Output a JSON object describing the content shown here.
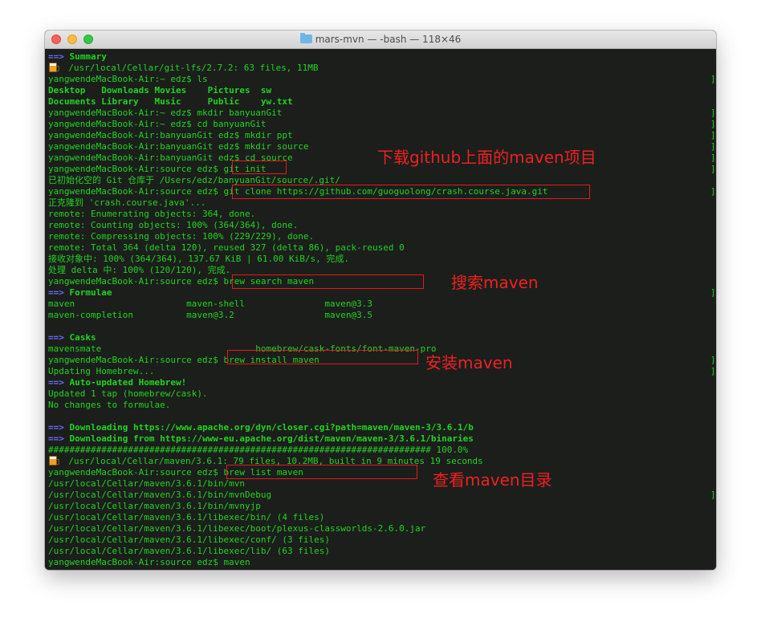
{
  "window": {
    "title": "mars-mvn — -bash — 118×46"
  },
  "icons": {
    "folder": "folder-icon",
    "beer": "beer-mug-icon",
    "traffic_lights": [
      "close-button",
      "minimize-button",
      "zoom-button"
    ]
  },
  "colors": {
    "terminal_bg": "#1c1e1c",
    "terminal_text": "#1fd51f",
    "arrow_blue": "#6b6bff",
    "annotation_red": "#ee2020"
  },
  "terminal": {
    "lines": [
      {
        "prefix": "==>",
        "text": "Summary",
        "bold": true
      },
      {
        "icon": "beer",
        "text": "  /usr/local/Cellar/git-lfs/2.7.2: 63 files, 11MB"
      },
      {
        "text": "yangwendeMacBook-Air:~ edz$ ls",
        "bracket": true
      },
      {
        "text": "Desktop   Downloads Movies    Pictures  sw",
        "bold": true
      },
      {
        "text": "Documents Library   Music     Public    yw.txt",
        "bold": true
      },
      {
        "text": "yangwendeMacBook-Air:~ edz$ mkdir banyuanGit",
        "bracket": true
      },
      {
        "text": "yangwendeMacBook-Air:~ edz$ cd banyuanGit",
        "bracket": true
      },
      {
        "text": "yangwendeMacBook-Air:banyuanGit edz$ mkdir ppt",
        "bracket": true
      },
      {
        "text": "yangwendeMacBook-Air:banyuanGit edz$ mkdir source",
        "bracket": true
      },
      {
        "text": "yangwendeMacBook-Air:banyuanGit edz$ cd source",
        "bracket": true
      },
      {
        "text": "yangwendeMacBook-Air:source edz$ git init",
        "bracket": true
      },
      {
        "text": "已初始化空的 Git 仓库于 /Users/edz/banyuanGit/source/.git/"
      },
      {
        "text": "yangwendeMacBook-Air:source edz$ git clone https://github.com/guoguolong/crash.course.java.git",
        "bracket": true
      },
      {
        "text": "正克隆到 'crash.course.java'..."
      },
      {
        "text": "remote: Enumerating objects: 364, done."
      },
      {
        "text": "remote: Counting objects: 100% (364/364), done."
      },
      {
        "text": "remote: Compressing objects: 100% (229/229), done."
      },
      {
        "text": "remote: Total 364 (delta 120), reused 327 (delta 86), pack-reused 0"
      },
      {
        "text": "接收对象中: 100% (364/364), 137.67 KiB | 61.00 KiB/s, 完成."
      },
      {
        "text": "处理 delta 中: 100% (120/120), 完成."
      },
      {
        "text": "yangwendeMacBook-Air:source edz$ brew search maven"
      },
      {
        "prefix": "==>",
        "text": "Formulae",
        "bold": true,
        "bracket": true
      },
      {
        "text": "maven                     maven-shell               maven@3.3"
      },
      {
        "text": "maven-completion          maven@3.2                 maven@3.5"
      },
      {
        "text": ""
      },
      {
        "prefix": "==>",
        "text": "Casks",
        "bold": true
      },
      {
        "text": "mavensmate                             homebrew/cask-fonts/font-maven-pro"
      },
      {
        "text": "yangwendeMacBook-Air:source edz$ brew install maven",
        "bracket": true
      },
      {
        "text": "Updating Homebrew...",
        "bracket": true
      },
      {
        "prefix": "==>",
        "text": "Auto-updated Homebrew!",
        "bold": true
      },
      {
        "text": "Updated 1 tap (homebrew/cask)."
      },
      {
        "text": "No changes to formulae."
      },
      {
        "text": ""
      },
      {
        "prefix": "==>",
        "text": "Downloading https://www.apache.org/dyn/closer.cgi?path=maven/maven-3/3.6.1/b",
        "bold": true
      },
      {
        "prefix": "==>",
        "text": "Downloading from https://www-eu.apache.org/dist/maven/maven-3/3.6.1/binaries",
        "bold": true
      },
      {
        "text": "######################################################################## 100.0%"
      },
      {
        "icon": "beer",
        "text": "  /usr/local/Cellar/maven/3.6.1: 79 files, 10.2MB, built in 9 minutes 19 seconds"
      },
      {
        "text": "yangwendeMacBook-Air:source edz$ brew list maven"
      },
      {
        "text": "/usr/local/Cellar/maven/3.6.1/bin/mvn"
      },
      {
        "text": "/usr/local/Cellar/maven/3.6.1/bin/mvnDebug",
        "bracket": true
      },
      {
        "text": "/usr/local/Cellar/maven/3.6.1/bin/mvnyjp"
      },
      {
        "text": "/usr/local/Cellar/maven/3.6.1/libexec/bin/ (4 files)"
      },
      {
        "text": "/usr/local/Cellar/maven/3.6.1/libexec/boot/plexus-classworlds-2.6.0.jar"
      },
      {
        "text": "/usr/local/Cellar/maven/3.6.1/libexec/conf/ (3 files)"
      },
      {
        "text": "/usr/local/Cellar/maven/3.6.1/libexec/lib/ (63 files)"
      },
      {
        "text": "yangwendeMacBook-Air:source edz$ maven"
      }
    ]
  },
  "annotations": [
    {
      "text": "下载github上面的maven项目"
    },
    {
      "text": "搜索maven"
    },
    {
      "text": "安装maven"
    },
    {
      "text": "查看maven目录"
    }
  ]
}
